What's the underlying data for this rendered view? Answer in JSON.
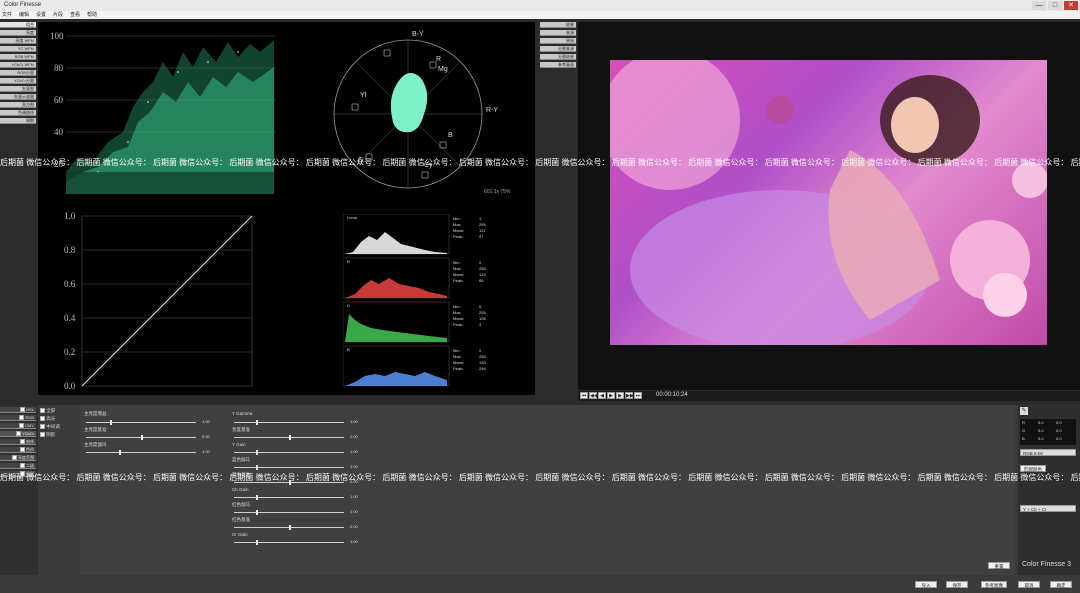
{
  "title": "Color Finesse",
  "window_controls": {
    "minimize": "—",
    "maximize": "□",
    "close": "✕"
  },
  "menu": [
    "文件",
    "编辑",
    "设置",
    "片段",
    "查看",
    "帮助"
  ],
  "scope_buttons": [
    "组合",
    "亮度",
    "亮度 WFM",
    "YC WFM",
    "RGB WFM",
    "YCbCr WFM",
    "RGB分量",
    "YCbCr分量",
    "矢量图",
    "矢量示波器",
    "直方图",
    "色调曲线",
    "周期"
  ],
  "waveform_ticks": [
    "100",
    "80",
    "60",
    "40",
    "20"
  ],
  "curve_ticks": [
    "1.0",
    "0.8",
    "0.6",
    "0.4",
    "0.2",
    "0.0"
  ],
  "vectorscope_labels": {
    "r": "R",
    "mg": "Mg",
    "by": "B-Y",
    "ry": "R-Y",
    "b": "B",
    "cy": "Cy",
    "g": "G",
    "yl": "Yl",
    "standard": "601  1x  75%"
  },
  "histograms": [
    {
      "name": "Luma",
      "stats": [
        "Min:",
        "Max:",
        "Mean:",
        "Peak:"
      ],
      "values": [
        "1",
        "255",
        "121",
        "97"
      ]
    },
    {
      "name": "R",
      "stats": [
        "Min:",
        "Max:",
        "Mean:",
        "Peak:"
      ],
      "values": [
        "0",
        "255",
        "124",
        "88"
      ]
    },
    {
      "name": "G",
      "stats": [
        "Min:",
        "Max:",
        "Mean:",
        "Peak:"
      ],
      "values": [
        "0",
        "255",
        "106",
        "3"
      ]
    },
    {
      "name": "B",
      "stats": [
        "Min:",
        "Max:",
        "Mean:",
        "Peak:"
      ],
      "values": [
        "0",
        "255",
        "130",
        "246"
      ]
    }
  ],
  "right_top_buttons": [
    "结果",
    "来源",
    "原始",
    "分割来源",
    "分割结果",
    "参考画面"
  ],
  "timecode": "00:00:10:24",
  "transport_icons": [
    "first",
    "prev",
    "step-back",
    "play",
    "step-fwd",
    "next",
    "last"
  ],
  "watermark": {
    "text": "后期菌 微信公众号：",
    "repeat": 15
  },
  "correction_tabs": [
    "HSL",
    "RGB",
    "CMY",
    "YCbCr",
    "曲线",
    "色阶",
    "亮度范围",
    "二级",
    "限制"
  ],
  "range_tabs": [
    "全部",
    "高光",
    "中间调",
    "阴影"
  ],
  "controls_left": [
    {
      "label": "主亮度增益",
      "value": "1.00",
      "knob_pct": 22
    },
    {
      "label": "主亮度基准",
      "value": "0.00",
      "knob_pct": 50
    },
    {
      "label": "主亮度伽玛",
      "value": "1.00",
      "knob_pct": 30
    }
  ],
  "controls_mid": [
    {
      "label": "Y Gamma",
      "value": "1.00",
      "knob_pct": 20
    },
    {
      "label": "亮度基准",
      "value": "0.00",
      "knob_pct": 50
    },
    {
      "label": "Y Gain",
      "value": "1.00",
      "knob_pct": 20
    },
    {
      "label": "蓝色伽马",
      "value": "1.00",
      "knob_pct": 20
    },
    {
      "label": "蓝色基准",
      "value": "0.00",
      "knob_pct": 50
    },
    {
      "label": "Cb Gain",
      "value": "1.00",
      "knob_pct": 20
    },
    {
      "label": "红色伽马",
      "value": "1.00",
      "knob_pct": 20
    },
    {
      "label": "红色基准",
      "value": "0.00",
      "knob_pct": 50
    },
    {
      "label": "Cr Gain",
      "value": "1.00",
      "knob_pct": 20
    }
  ],
  "reset_label": "重置",
  "color_readout": {
    "rows": [
      [
        "R",
        "0.0",
        "0.0"
      ],
      [
        "G",
        "0.0",
        "0.0"
      ],
      [
        "B",
        "0.0",
        "0.0"
      ]
    ],
    "mode": "RGB 8-bit",
    "ycc_mode": "Y + Cb + Cr",
    "match_label": "匹配颜色"
  },
  "brand": "Color Finesse 3",
  "bottom_buttons": [
    "导入",
    "保存",
    "参考图像",
    "取消",
    "确定"
  ]
}
